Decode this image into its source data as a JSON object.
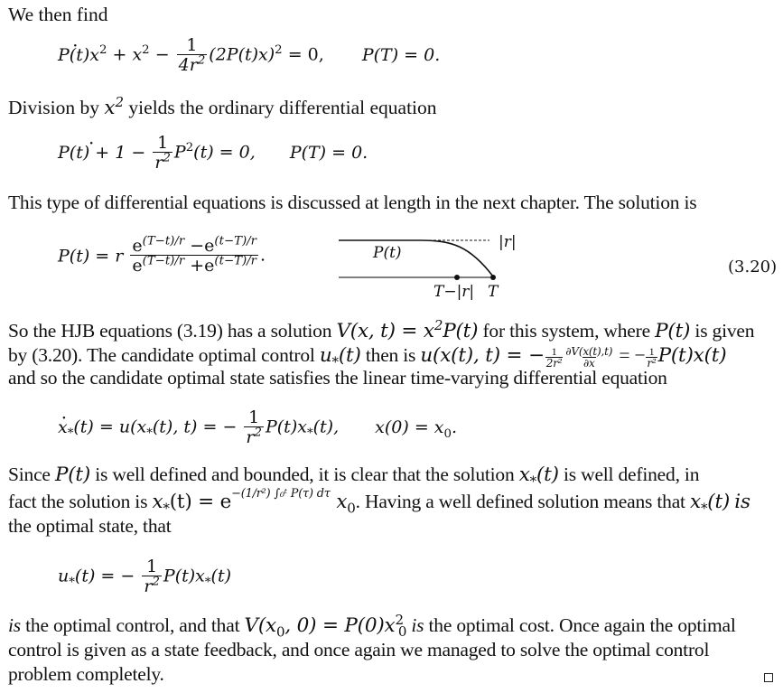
{
  "paragraphs": {
    "p1": "We then find",
    "p2_pre": "Division by",
    "p2_post": "yields the ordinary differential equation",
    "p3": "This type of differential equations is discussed at length in the next chapter. The solution is",
    "p4_line1_a": "So the HJB equations (3.19) has a solution",
    "p4_line1_b": "for this system, where",
    "p4_line1_c": "is given",
    "p4_line2_a": "by (3.20). The candidate optimal control",
    "p4_line2_b": "then is",
    "p4_line3": "and so the candidate optimal state satisfies the linear time-varying differential equation",
    "p5_line1_a": "Since",
    "p5_line1_b": "is well defined and bounded, it is clear that the solution",
    "p5_line1_c": "is well defined, in",
    "p5_line2_a": "fact the solution is",
    "p5_line2_b": ". Having a well defined solution means that",
    "p5_line2_c": "is",
    "p5_line3": "the optimal state, that",
    "p6_line1_a": "is",
    "p6_line1_b": "the optimal control, and that",
    "p6_line1_c": "is",
    "p6_line1_d": "the optimal cost. Once again the optimal",
    "p6_line2": "control is given as a state feedback, and once again we managed to solve the optimal control",
    "p6_line3": "problem completely."
  },
  "equations": {
    "eq1": {
      "lhs_a": "P(t)x",
      "plus": "+ x",
      "minus": "−",
      "frac_num": "1",
      "frac_den": "4r",
      "rest": "(2P(t)x)",
      "eq_zero": "= 0,",
      "bc": "P(T) = 0."
    },
    "eq2": {
      "lhs": "P(t) + 1 −",
      "frac_num": "1",
      "frac_den": "r",
      "rest": "P",
      "rest2": "(t) = 0,",
      "bc": "P(T) = 0."
    },
    "eq3": {
      "lhs": "P(t) = r",
      "num": "e^{(T−t)/r} − e^{(t−T)/r}",
      "den": "e^{(T−t)/r} + e^{(t−T)/r}",
      "num_a_exp": "(T−t)/r",
      "num_b_exp": "(t−T)/r",
      "e": "e",
      "minus": "−",
      "plus": "+",
      "period": ".",
      "number": "(3.20)"
    },
    "eq4": {
      "lhs": "x",
      "mid": "(t) = u(x",
      "mid2": "(t), t) = −",
      "frac_num": "1",
      "frac_den": "r",
      "rest": "P(t)x",
      "rest2": "(t),",
      "bc": "x(0) = x",
      "bc_sub": "0",
      "bc_end": "."
    },
    "eq5": {
      "lhs": "u",
      "mid": "(t) = −",
      "frac_num": "1",
      "frac_den": "r",
      "rest": "P(t)x",
      "rest2": "(t)"
    }
  },
  "figure": {
    "curve_label": "P(t)",
    "asymptote_label": "|r|",
    "tick_left_label": "T−|r|",
    "tick_right_label": "T"
  },
  "inline": {
    "V_eq": "V(x, t) = x",
    "P_t": "P(t)",
    "u_star": "u",
    "u_formula_a": "u(x(t), t) = −",
    "u_frac1_num": "1",
    "u_frac1_den": "2r²",
    "u_frac2_num": "∂V(x(t),t)",
    "u_frac2_den": "∂x",
    "u_eq2": "= −",
    "u_frac3_num": "1",
    "u_frac3_den": "r²",
    "u_tail": "P(t)x(t)",
    "x_star": "x",
    "x_sol_a": "(t) = e",
    "x_sol_exp": "−(1/r²) ∫₀ᵗ P(τ) dτ",
    "x0": "x",
    "V0": "V(x",
    "V0_b": ", 0) = P(0)x",
    "star": "*",
    "t_arg": "(t)",
    "two": "2",
    "zero": "0"
  },
  "qed_symbol": "□"
}
